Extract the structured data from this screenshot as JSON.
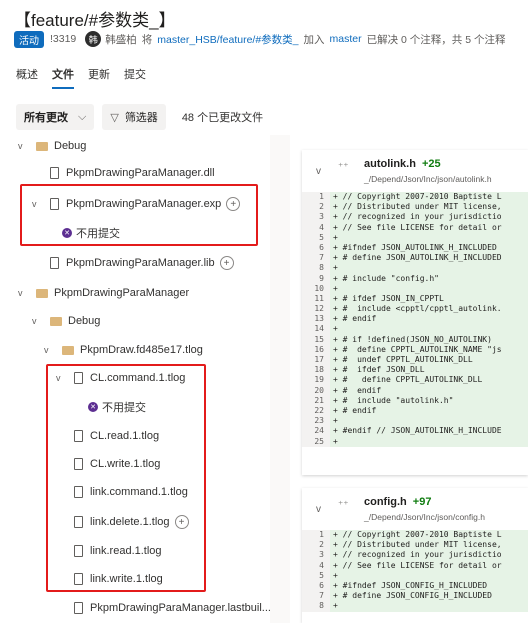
{
  "pr": {
    "title": "【feature/#参数类_】",
    "status": "活动",
    "id": "!3319",
    "avatar_char": "韩",
    "author": "韩盛柏",
    "merge_word": "将",
    "source_branch": "master_HSB/feature/#参数类_",
    "into_word": "加入",
    "target_branch": "master",
    "stats": "已解决 0 个注释，共 5 个注释"
  },
  "tabs": [
    "概述",
    "文件",
    "更新",
    "提交"
  ],
  "toolbar": {
    "changes_label": "所有更改",
    "filter_label": "筛选器",
    "file_count": "48 个已更改文件"
  },
  "tree": [
    {
      "label": "Debug",
      "kind": "folder",
      "caret": "v"
    },
    {
      "label": "PkpmDrawingParaManager.dll",
      "kind": "file"
    },
    {
      "label": "PkpmDrawingParaManager.exp",
      "kind": "file",
      "caret": "v",
      "plus": true
    },
    {
      "label": "不用提交",
      "kind": "comment"
    },
    {
      "label": "PkpmDrawingParaManager.lib",
      "kind": "file",
      "plus": true
    },
    {
      "label": "PkpmDrawingParaManager",
      "kind": "folder",
      "caret": "v"
    },
    {
      "label": "Debug",
      "kind": "folder",
      "caret": "v"
    },
    {
      "label": "PkpmDraw.fd485e17.tlog",
      "kind": "folder",
      "caret": "v"
    },
    {
      "label": "CL.command.1.tlog",
      "kind": "file",
      "caret": "v"
    },
    {
      "label": "不用提交",
      "kind": "comment"
    },
    {
      "label": "CL.read.1.tlog",
      "kind": "file"
    },
    {
      "label": "CL.write.1.tlog",
      "kind": "file"
    },
    {
      "label": "link.command.1.tlog",
      "kind": "file"
    },
    {
      "label": "link.delete.1.tlog",
      "kind": "file",
      "plus": true
    },
    {
      "label": "link.read.1.tlog",
      "kind": "file"
    },
    {
      "label": "link.write.1.tlog",
      "kind": "file"
    },
    {
      "label": "PkpmDrawingParaManager.lastbuil...",
      "kind": "file"
    }
  ],
  "files": [
    {
      "name": "autolink.h",
      "added": "+25",
      "path": "_/Depend/Json/Inc/json/autolink.h",
      "lines": [
        "+ // Copyright 2007-2010 Baptiste L",
        "+ // Distributed under MIT license,",
        "+ // recognized in your jurisdictio",
        "+ // See file LICENSE for detail or",
        "+",
        "+ #ifndef JSON_AUTOLINK_H_INCLUDED",
        "+ # define JSON_AUTOLINK_H_INCLUDED",
        "+",
        "+ # include \"config.h\"",
        "+",
        "+ # ifdef JSON_IN_CPPTL",
        "+ #  include <cpptl/cpptl_autolink.",
        "+ # endif",
        "+",
        "+ # if !defined(JSON_NO_AUTOLINK)",
        "+ #  define CPPTL_AUTOLINK_NAME \"js",
        "+ #  undef CPPTL_AUTOLINK_DLL",
        "+ #  ifdef JSON_DLL",
        "+ #   define CPPTL_AUTOLINK_DLL",
        "+ #  endif",
        "+ #  include \"autolink.h\"",
        "+ # endif",
        "+",
        "+ #endif // JSON_AUTOLINK_H_INCLUDE",
        "+"
      ]
    },
    {
      "name": "config.h",
      "added": "+97",
      "path": "_/Depend/Json/Inc/json/config.h",
      "lines": [
        "+ // Copyright 2007-2010 Baptiste L",
        "+ // Distributed under MIT license,",
        "+ // recognized in your jurisdictio",
        "+ // See file LICENSE for detail or",
        "+",
        "+ #ifndef JSON_CONFIG_H_INCLUDED",
        "+ # define JSON_CONFIG_H_INCLUDED",
        "+"
      ]
    }
  ]
}
